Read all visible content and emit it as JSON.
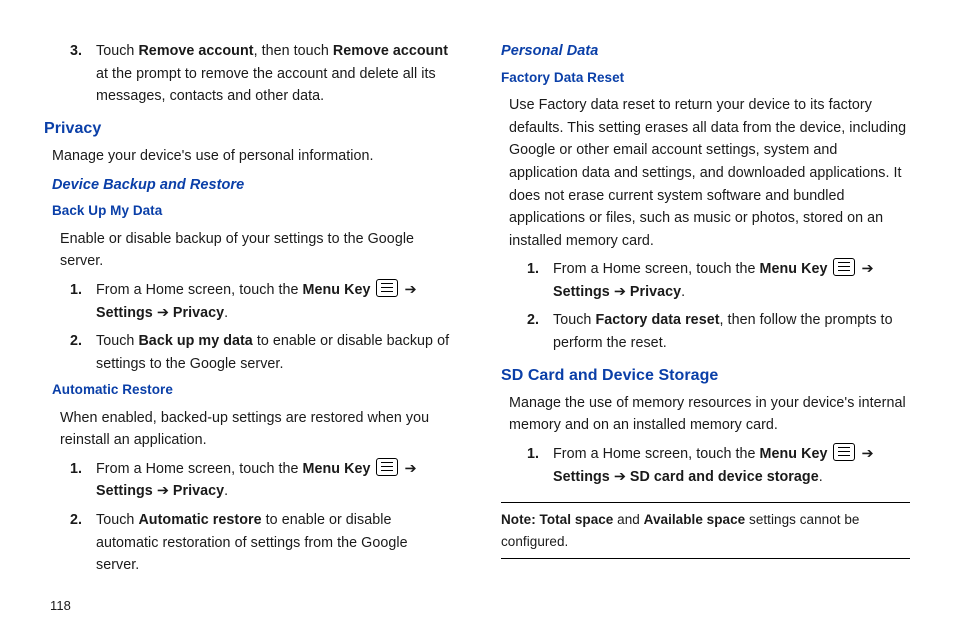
{
  "pageNumber": "118",
  "left": {
    "step3": {
      "n": "3.",
      "pre": "Touch ",
      "b1": "Remove account",
      "mid": ", then touch ",
      "b2": "Remove account",
      "post": " at the prompt to remove the account and delete all its messages, contacts and other data."
    },
    "privacy": {
      "title": "Privacy",
      "intro": "Manage your device's use of personal information.",
      "backupRestore": "Device Backup and Restore",
      "backUpMyData": {
        "title": "Back Up My Data",
        "intro": "Enable or disable backup of your settings to the Google server.",
        "s1": {
          "n": "1.",
          "pre": "From a Home screen, touch the ",
          "bMenuKey": "Menu Key",
          "arrow1": " ➔ ",
          "bSettings": "Settings",
          "arrow2": " ➔ ",
          "bPrivacy": "Privacy",
          "post": "."
        },
        "s2": {
          "n": "2.",
          "pre": "Touch ",
          "b1": "Back up my data",
          "post": " to enable or disable backup of settings to the Google server."
        }
      },
      "autoRestore": {
        "title": "Automatic Restore",
        "intro": "When enabled, backed-up settings are restored when you reinstall an application.",
        "s1": {
          "n": "1.",
          "pre": "From a Home screen, touch the ",
          "bMenuKey": "Menu Key",
          "arrow1": " ➔ ",
          "bSettings": "Settings",
          "arrow2": " ➔ ",
          "bPrivacy": "Privacy",
          "post": "."
        },
        "s2": {
          "n": "2.",
          "pre": "Touch ",
          "b1": "Automatic restore",
          "post": " to enable or disable automatic restoration of settings from the Google server."
        }
      }
    }
  },
  "right": {
    "personalData": {
      "title": "Personal Data",
      "factory": {
        "title": "Factory Data Reset",
        "intro": "Use Factory data reset to return your device to its factory defaults. This setting erases all data from the device, including Google or other email account settings, system and application data and settings, and downloaded applications. It does not erase current system software and bundled applications or files, such as music or photos, stored on an installed memory card.",
        "s1": {
          "n": "1.",
          "pre": "From a Home screen, touch the ",
          "bMenuKey": "Menu Key",
          "arrow1": " ➔ ",
          "bSettings": "Settings",
          "arrow2": " ➔ ",
          "bPrivacy": "Privacy",
          "post": "."
        },
        "s2": {
          "n": "2.",
          "pre": "Touch ",
          "b1": "Factory data reset",
          "post": ", then follow the prompts to perform the reset."
        }
      }
    },
    "sd": {
      "title": "SD Card and Device Storage",
      "intro": "Manage the use of memory resources in your device's internal memory and on an installed memory card.",
      "s1": {
        "n": "1.",
        "pre": "From a Home screen, touch the ",
        "bMenuKey": "Menu Key",
        "arrow1": " ➔ ",
        "bSettings": "Settings",
        "arrow2": " ➔ ",
        "bTarget": "SD card and device storage",
        "post": "."
      }
    },
    "note": {
      "b1": "Note: Total space",
      "mid": " and ",
      "b2": "Available space",
      "post": " settings cannot be configured."
    }
  }
}
